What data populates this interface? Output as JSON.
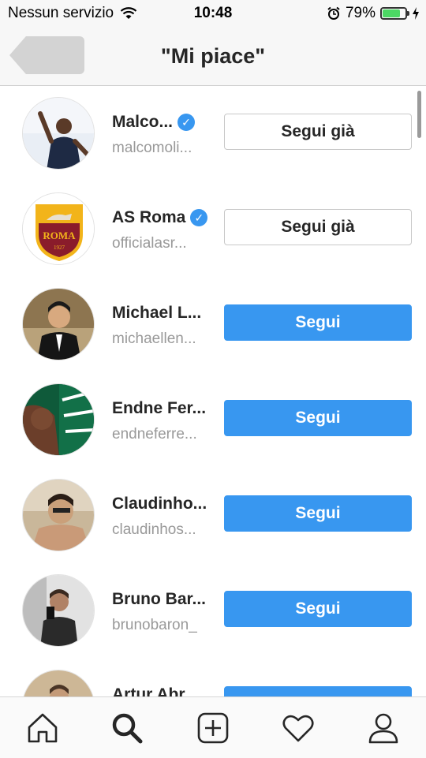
{
  "status_bar": {
    "carrier": "Nessun servizio",
    "time": "10:48",
    "battery_percent": "79%",
    "battery_level": 0.79,
    "icons": [
      "wifi-icon",
      "alarm-icon",
      "battery-icon",
      "charging-icon"
    ]
  },
  "header": {
    "title": "\"Mi piace\"",
    "back_icon": "back-arrow-icon"
  },
  "users": [
    {
      "name": "Malco...",
      "handle": "malcomoli...",
      "verified": true,
      "button": "Segui già",
      "state": "following"
    },
    {
      "name": "AS Roma",
      "handle": "officialasr...",
      "verified": true,
      "button": "Segui già",
      "state": "following"
    },
    {
      "name": "Michael L...",
      "handle": "michaellen...",
      "verified": false,
      "button": "Segui",
      "state": "follow"
    },
    {
      "name": "Endne Fer...",
      "handle": "endneferre...",
      "verified": false,
      "button": "Segui",
      "state": "follow"
    },
    {
      "name": "Claudinho...",
      "handle": "claudinhos...",
      "verified": false,
      "button": "Segui",
      "state": "follow"
    },
    {
      "name": "Bruno Bar...",
      "handle": "brunobaron_",
      "verified": false,
      "button": "Segui",
      "state": "follow"
    },
    {
      "name": "Artur Abr...",
      "handle": "",
      "verified": false,
      "button": "",
      "state": "follow"
    }
  ],
  "avatar_logo_text": {
    "club": "ROMA",
    "year": "1927"
  },
  "tab_bar": {
    "items": [
      "home-icon",
      "search-icon",
      "new-post-icon",
      "activity-heart-icon",
      "profile-icon"
    ],
    "active": "search-icon"
  },
  "colors": {
    "follow_blue": "#3897f0",
    "verified_blue": "#3897f0",
    "battery_green": "#4cd964"
  }
}
